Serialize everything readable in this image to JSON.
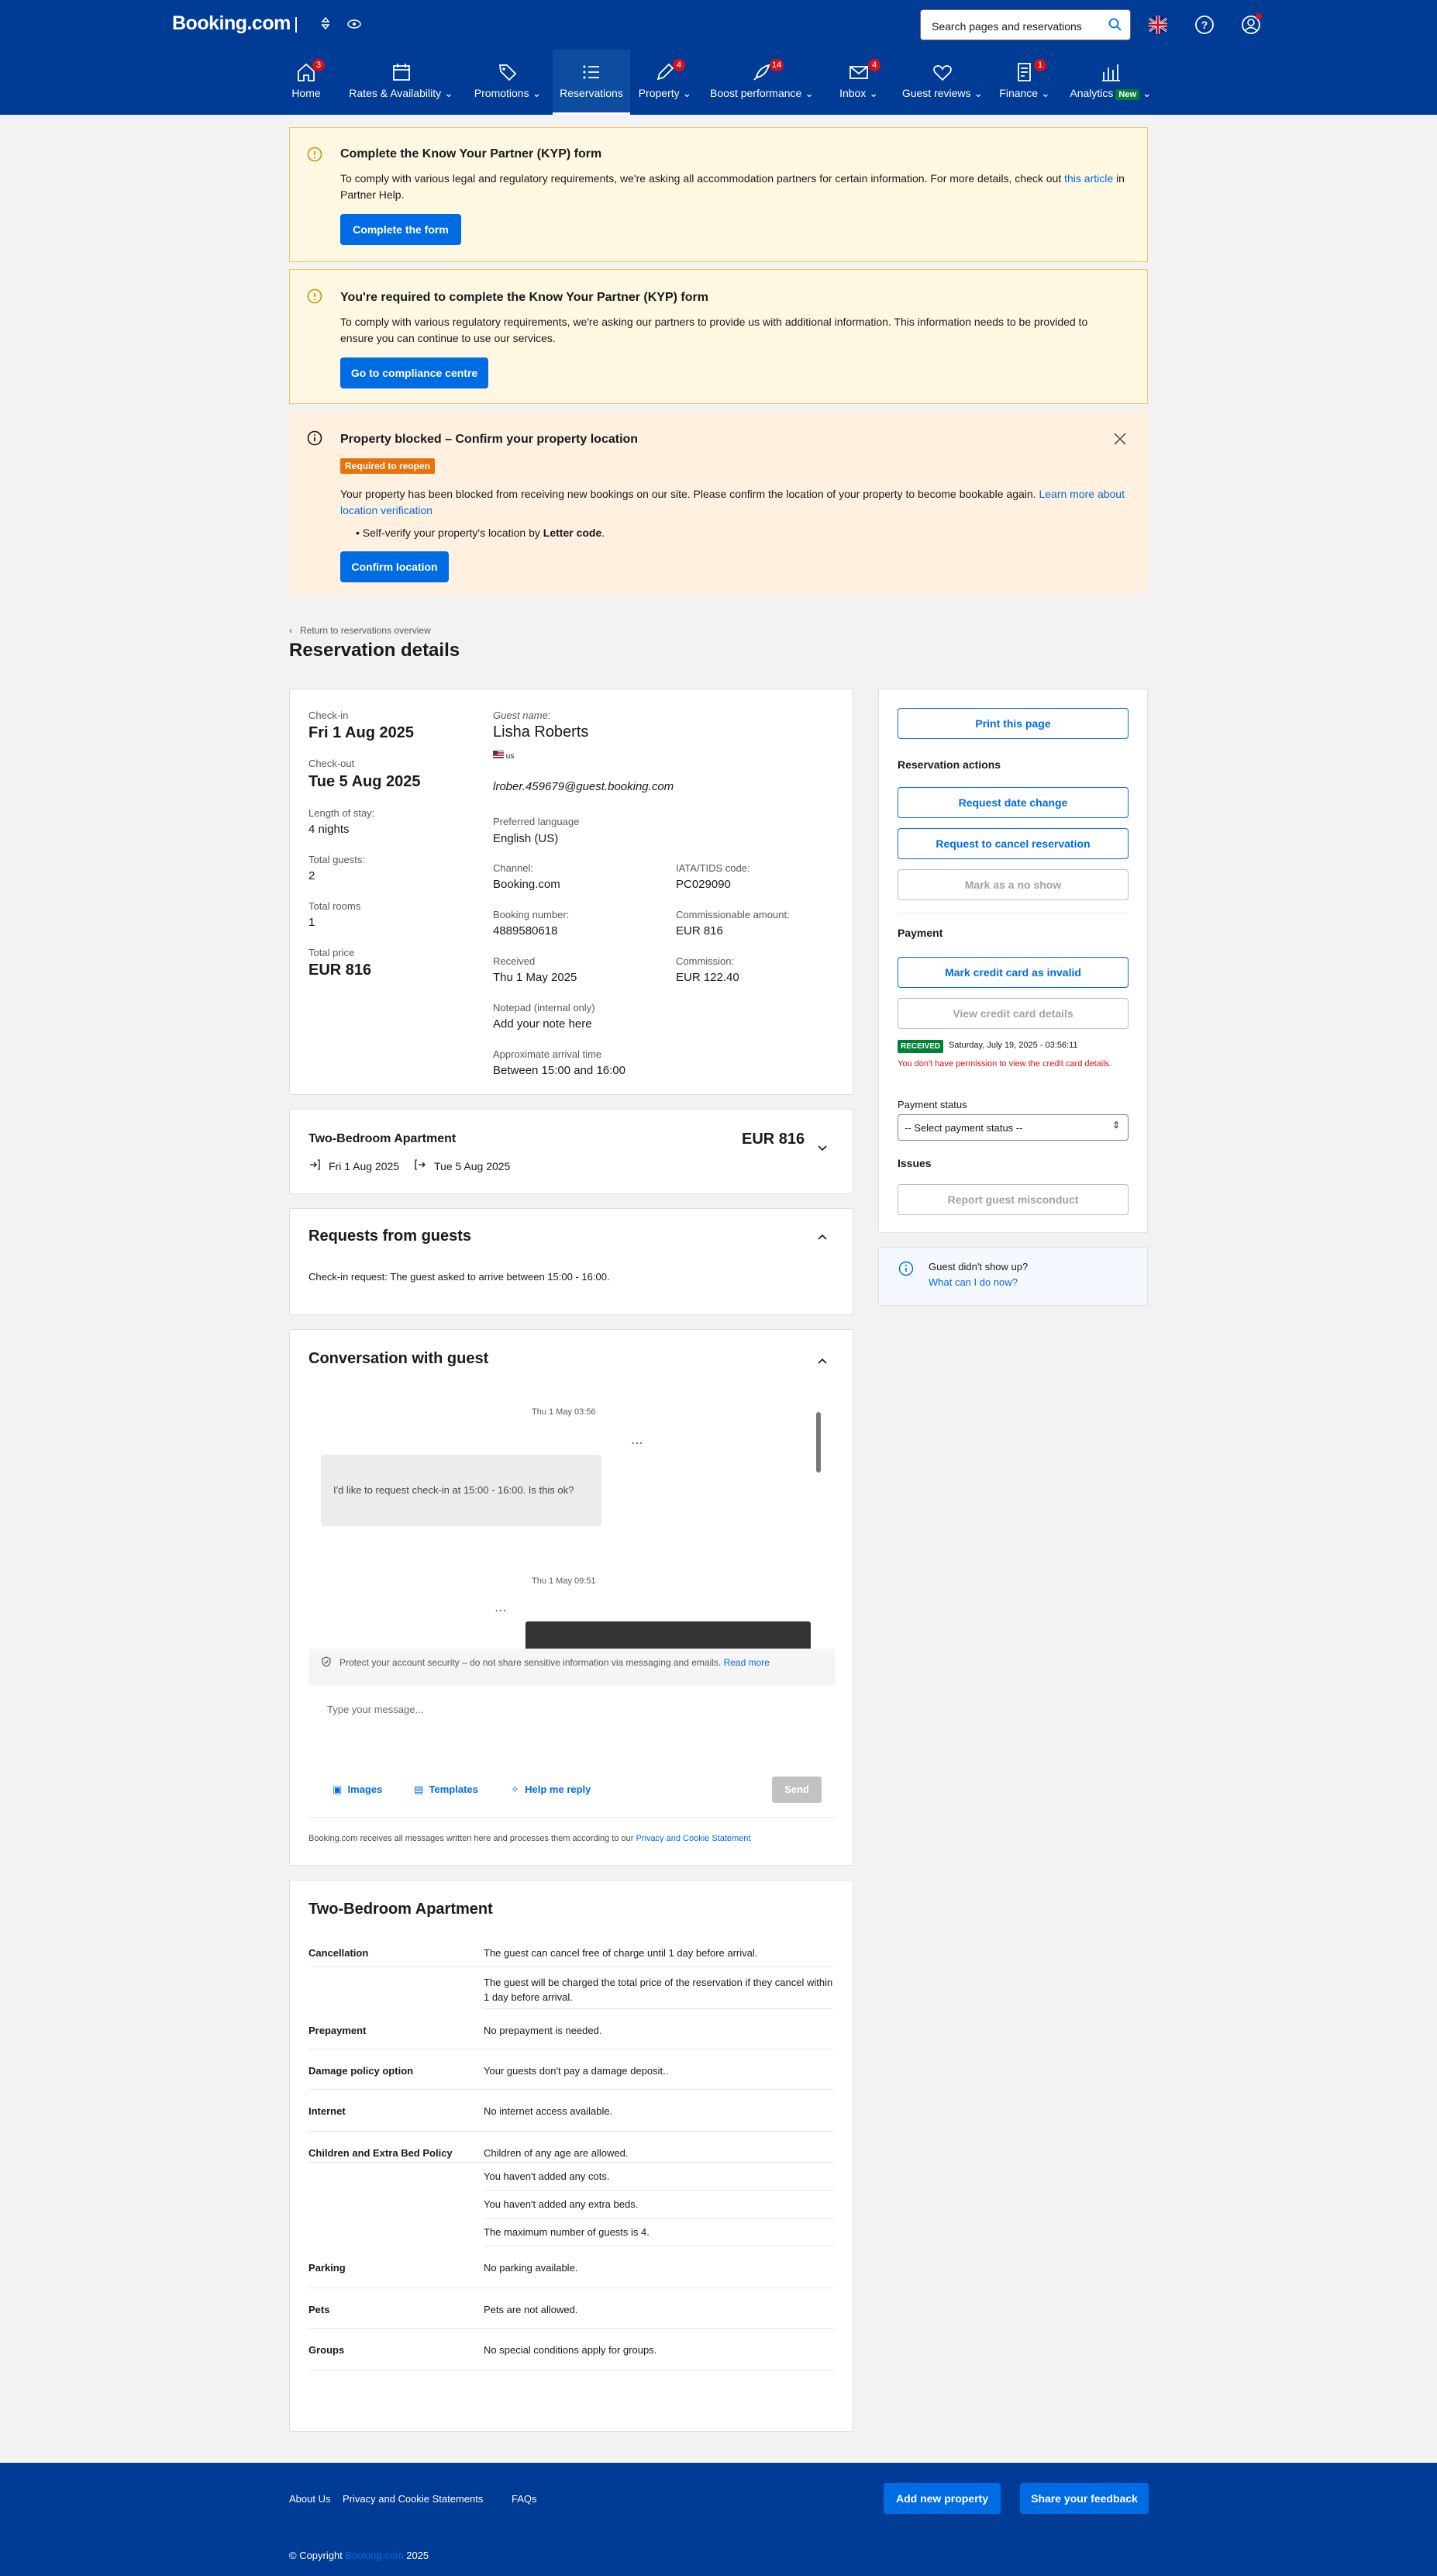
{
  "header": {
    "logo": "Booking.com",
    "search_placeholder": "Search pages and reservations"
  },
  "nav": [
    {
      "label": "Home",
      "badge": "3"
    },
    {
      "label": "Rates & Availability",
      "badge": ""
    },
    {
      "label": "Promotions",
      "badge": ""
    },
    {
      "label": "Reservations",
      "badge": ""
    },
    {
      "label": "Property",
      "badge": "4"
    },
    {
      "label": "Boost performance",
      "badge": "14"
    },
    {
      "label": "Inbox",
      "badge": "4"
    },
    {
      "label": "Guest reviews",
      "badge": ""
    },
    {
      "label": "Finance",
      "badge": "1"
    },
    {
      "label": "Analytics",
      "badge": "",
      "tag": "New"
    }
  ],
  "banners": {
    "kyp1": {
      "title": "Complete the Know Your Partner (KYP) form",
      "text": "To comply with various legal and regulatory requirements, we're asking all accommodation partners for certain information. For more details, check out",
      "link": "this article",
      "text_end": "in Partner Help.",
      "button": "Complete the form"
    },
    "kyp2": {
      "title": "You're required to complete the Know Your Partner (KYP) form",
      "text": "To comply with various regulatory requirements, we're asking our partners to provide us with additional information. This information needs to be provided to ensure you can continue to use our services.",
      "button": "Go to compliance centre"
    },
    "blocked": {
      "title": "Property blocked – Confirm your property location",
      "tag": "Required to reopen",
      "text": "Your property has been blocked from receiving new bookings on our site. Please confirm the location of your property to become bookable again.",
      "link": "Learn more about location verification",
      "bullet_pre": "Self-verify your property's location by",
      "bullet_bold": "Letter code",
      "bullet_end": ".",
      "button": "Confirm location"
    }
  },
  "breadcrumb": "Return to reservations overview",
  "page_title": "Reservation details",
  "details": {
    "checkin_label": "Check-in",
    "checkin": "Fri 1 Aug 2025",
    "checkout_label": "Check-out",
    "checkout": "Tue 5 Aug 2025",
    "los_label": "Length of stay:",
    "los": "4 nights",
    "guests_label": "Total guests:",
    "guests": "2",
    "rooms_label": "Total rooms",
    "rooms": "1",
    "price_label": "Total price",
    "price": "EUR 816",
    "guest_name_label": "Guest name:",
    "guest_name": "Lisha Roberts",
    "country": "us",
    "email": "lrober.459679@guest.booking.com",
    "lang_label": "Preferred language",
    "lang": "English (US)",
    "channel_label": "Channel:",
    "channel": "Booking.com",
    "iata_label": "IATA/TIDS code:",
    "iata": "PC029090",
    "booking_label": "Booking number:",
    "booking": "4889580618",
    "comm_amount_label": "Commissionable amount:",
    "comm_amount": "EUR 816",
    "received_label": "Received",
    "received": "Thu 1 May 2025",
    "commission_label": "Commission:",
    "commission": "EUR 122.40",
    "notepad_label": "Notepad (internal only)",
    "notepad_link": "Add your note here",
    "arrival_label": "Approximate arrival time",
    "arrival": "Between 15:00 and 16:00"
  },
  "room_card": {
    "name": "Two-Bedroom Apartment",
    "price": "EUR 816",
    "checkin": "Fri 1 Aug 2025",
    "checkout": "Tue 5 Aug 2025"
  },
  "requests": {
    "title": "Requests from guests",
    "text": "Check-in request: The guest asked to arrive between 15:00 - 16:00."
  },
  "conversation": {
    "title": "Conversation with guest",
    "time1": "Thu 1 May 03:56",
    "msg1": "I'd like to request check-in at 15:00 - 16:00. Is this ok?",
    "time2": "Thu 1 May 09:51",
    "security": "Protect your account security – do not share sensitive information via messaging and emails.",
    "security_link": "Read more",
    "placeholder": "Type your message...",
    "images": "Images",
    "templates": "Templates",
    "help": "Help me reply",
    "send": "Send",
    "privacy_pre": "Booking.com receives all messages written here and processes them according to our",
    "privacy_link": "Privacy and Cookie Statement"
  },
  "policies": {
    "title": "Two-Bedroom Apartment",
    "rows": [
      {
        "label": "Cancellation",
        "values": [
          "The guest can cancel free of charge until 1 day before arrival.",
          "The guest will be charged the total price of the reservation if they cancel within 1 day before arrival."
        ]
      },
      {
        "label": "Prepayment",
        "values": [
          "No prepayment is needed."
        ]
      },
      {
        "label": "Damage policy option",
        "values": [
          "Your guests don't pay a damage deposit.."
        ]
      },
      {
        "label": "Internet",
        "values": [
          "No internet access available."
        ]
      },
      {
        "label": "Children and Extra Bed Policy",
        "values": [
          "Children of any age are allowed.",
          "You haven't added any cots.",
          "You haven't added any extra beds.",
          "The maximum number of guests is 4."
        ]
      },
      {
        "label": "Parking",
        "values": [
          "No parking available."
        ]
      },
      {
        "label": "Pets",
        "values": [
          "Pets are not allowed."
        ]
      },
      {
        "label": "Groups",
        "values": [
          "No special conditions apply for groups."
        ]
      }
    ]
  },
  "sidebar": {
    "print": "Print this page",
    "actions_title": "Reservation actions",
    "date_change": "Request date change",
    "cancel": "Request to cancel reservation",
    "no_show": "Mark as a no show",
    "payment_title": "Payment",
    "mark_invalid": "Mark credit card as invalid",
    "view_cc": "View credit card details",
    "received_badge": "RECEIVED",
    "received_date": "Saturday, July 19, 2025 - 03:56:11",
    "no_permission": "You don't have permission to view the credit card details.",
    "payment_status_label": "Payment status",
    "payment_status_value": "-- Select payment status --",
    "issues_title": "Issues",
    "report": "Report guest misconduct",
    "noshow_q": "Guest didn't show up?",
    "noshow_link": "What can I do now?"
  },
  "footer": {
    "links": [
      "About Us",
      "Privacy and Cookie Statements",
      "FAQs"
    ],
    "add_property": "Add new property",
    "feedback": "Share your feedback",
    "copyright_pre": "© Copyright",
    "copyright_link": "Booking.com",
    "copyright_year": "2025"
  }
}
